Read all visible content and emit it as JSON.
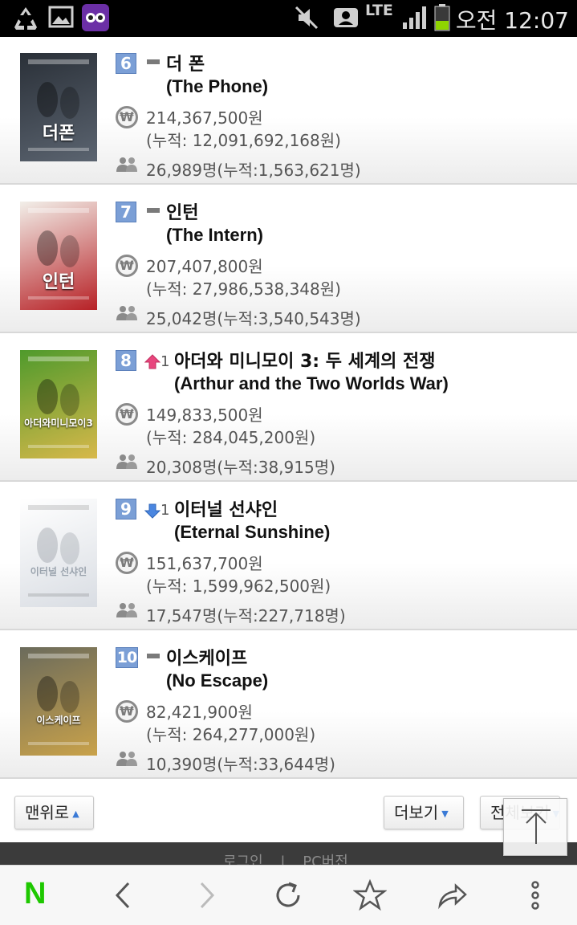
{
  "status_bar": {
    "network": "LTE",
    "time": "오전 12:07",
    "icons": [
      "recycle-icon",
      "image-icon",
      "app-owl-icon",
      "mute-icon",
      "contact-icon",
      "signal-icon",
      "battery-icon"
    ]
  },
  "movies": [
    {
      "rank": "6",
      "change": "none",
      "change_value": "",
      "title_ko": "더 폰",
      "title_en": "(The Phone)",
      "sales": "214,367,500원",
      "cumulative_sales": "(누적: 12,091,692,168원)",
      "audience": "26,989명(누적:1,563,621명)",
      "poster_text": "더폰",
      "poster_colors": [
        "#2a3038",
        "#5b6470"
      ]
    },
    {
      "rank": "7",
      "change": "none",
      "change_value": "",
      "title_ko": "인턴",
      "title_en": "(The Intern)",
      "sales": "207,407,800원",
      "cumulative_sales": "(누적: 27,986,538,348원)",
      "audience": "25,042명(누적:3,540,543명)",
      "poster_text": "인턴",
      "poster_colors": [
        "#f2efe9",
        "#b72126"
      ]
    },
    {
      "rank": "8",
      "change": "up",
      "change_value": "1",
      "title_ko": "아더와 미니모이 3: 두 세계의 전쟁",
      "title_en": "(Arthur and the Two Worlds War)",
      "sales": "149,833,500원",
      "cumulative_sales": "(누적: 284,045,200원)",
      "audience": "20,308명(누적:38,915명)",
      "poster_text": "아더와미니모이3",
      "poster_colors": [
        "#4f9a2c",
        "#d7b84a"
      ]
    },
    {
      "rank": "9",
      "change": "down",
      "change_value": "1",
      "title_ko": "이터널 선샤인",
      "title_en": "(Eternal Sunshine)",
      "sales": "151,637,700원",
      "cumulative_sales": "(누적: 1,599,962,500원)",
      "audience": "17,547명(누적:227,718명)",
      "poster_text": "이터널 선샤인",
      "poster_colors": [
        "#ffffff",
        "#d9dde3"
      ]
    },
    {
      "rank": "10",
      "change": "none",
      "change_value": "",
      "title_ko": "이스케이프",
      "title_en": "(No Escape)",
      "sales": "82,421,900원",
      "cumulative_sales": "(누적: 264,277,000원)",
      "audience": "10,390명(누적:33,644명)",
      "poster_text": "이스케이프",
      "poster_colors": [
        "#6b6b5c",
        "#c9a24a"
      ]
    }
  ],
  "controls": {
    "to_top_label": "맨위로",
    "more_label": "더보기",
    "view_all_label": "전체보기"
  },
  "footer": {
    "login": "로그인",
    "separator": "|",
    "pc_version": "PC버전"
  },
  "browser_bar": {
    "home_logo": "N",
    "icons": [
      "naver-home-icon",
      "back-icon",
      "forward-icon",
      "refresh-icon",
      "bookmark-star-icon",
      "share-icon",
      "more-menu-icon"
    ]
  },
  "colors": {
    "rank_badge": "#7b9fd6",
    "up_arrow": "#e8457d",
    "down_arrow": "#4a86e0",
    "naver_green": "#1ec800"
  }
}
